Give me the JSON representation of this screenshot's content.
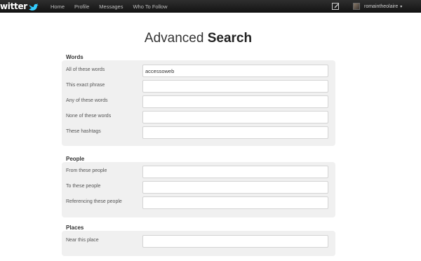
{
  "topbar": {
    "logo_text": "witter",
    "nav": [
      "Home",
      "Profile",
      "Messages",
      "Who To Follow"
    ],
    "username": "romaintheolaire"
  },
  "page": {
    "title_light": "Advanced ",
    "title_bold": "Search"
  },
  "sections": {
    "words": {
      "title": "Words",
      "fields": [
        {
          "label": "All of these words",
          "value": "accessoweb"
        },
        {
          "label": "This exact phrase",
          "value": ""
        },
        {
          "label": "Any of these words",
          "value": ""
        },
        {
          "label": "None of these words",
          "value": ""
        },
        {
          "label": "These hashtags",
          "value": ""
        }
      ]
    },
    "people": {
      "title": "People",
      "fields": [
        {
          "label": "From these people",
          "value": ""
        },
        {
          "label": "To these people",
          "value": ""
        },
        {
          "label": "Referencing these people",
          "value": ""
        }
      ]
    },
    "places": {
      "title": "Places",
      "fields": [
        {
          "label": "Near this place",
          "value": ""
        }
      ]
    }
  },
  "icons": {
    "logo_bird": "twitter-bird-icon",
    "compose": "compose-icon",
    "user_menu": "caret-down-icon"
  },
  "colors": {
    "topbar": "#1f1f1f",
    "logo_bird": "#33ccff",
    "section_bg": "#f0f0f0"
  }
}
